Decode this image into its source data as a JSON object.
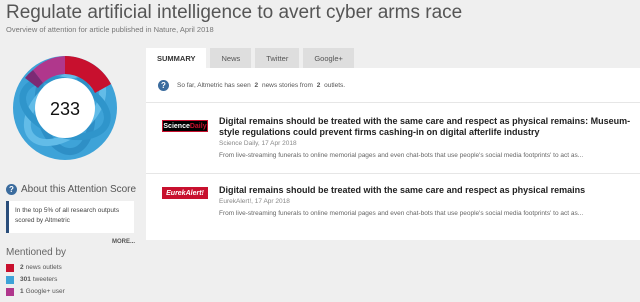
{
  "header": {
    "title": "Regulate artificial intelligence to avert cyber arms race",
    "subtitle": "Overview of attention for article published in Nature, April 2018"
  },
  "score": {
    "value": "233",
    "about_label": "About this Attention Score",
    "description": "In the top 5% of all research outputs scored by Altmetric",
    "more_label": "MORE..."
  },
  "mentioned": {
    "heading": "Mentioned by",
    "items": [
      {
        "count": "2",
        "label": "news outlets",
        "color": "#c8102e"
      },
      {
        "count": "301",
        "label": "tweeters",
        "color": "#3ea3d8"
      },
      {
        "count": "1",
        "label": "Google+ user",
        "color": "#b0378c"
      }
    ]
  },
  "tabs": [
    {
      "label": "SUMMARY",
      "active": true
    },
    {
      "label": "News",
      "active": false
    },
    {
      "label": "Twitter",
      "active": false
    },
    {
      "label": "Google+",
      "active": false
    }
  ],
  "summary": {
    "prefix": "So far, Altmetric has seen",
    "stories": "2",
    "middle": "news stories from",
    "outlets": "2",
    "suffix": "outlets."
  },
  "stories": [
    {
      "logo": "ScienceDaily",
      "title": "Digital remains should be treated with the same care and respect as physical remains: Museum-style regulations could prevent firms cashing-in on digital afterlife industry",
      "meta": "Science Daily, 17 Apr 2018",
      "excerpt": "From live-streaming funerals to online memorial pages and even chat-bots that use people's social media footprints' to act as..."
    },
    {
      "logo": "EurekAlert!",
      "title": "Digital remains should be treated with the same care and respect as physical remains",
      "meta": "EurekAlert!, 17 Apr 2018",
      "excerpt": "From live-streaming funerals to online memorial pages and even chat-bots that use people's social media footprints' to act as..."
    }
  ],
  "colors": {
    "news": "#c8102e",
    "twitter": "#3ea3d8",
    "googleplus": "#b0378c",
    "accent": "#2a4d7a"
  }
}
